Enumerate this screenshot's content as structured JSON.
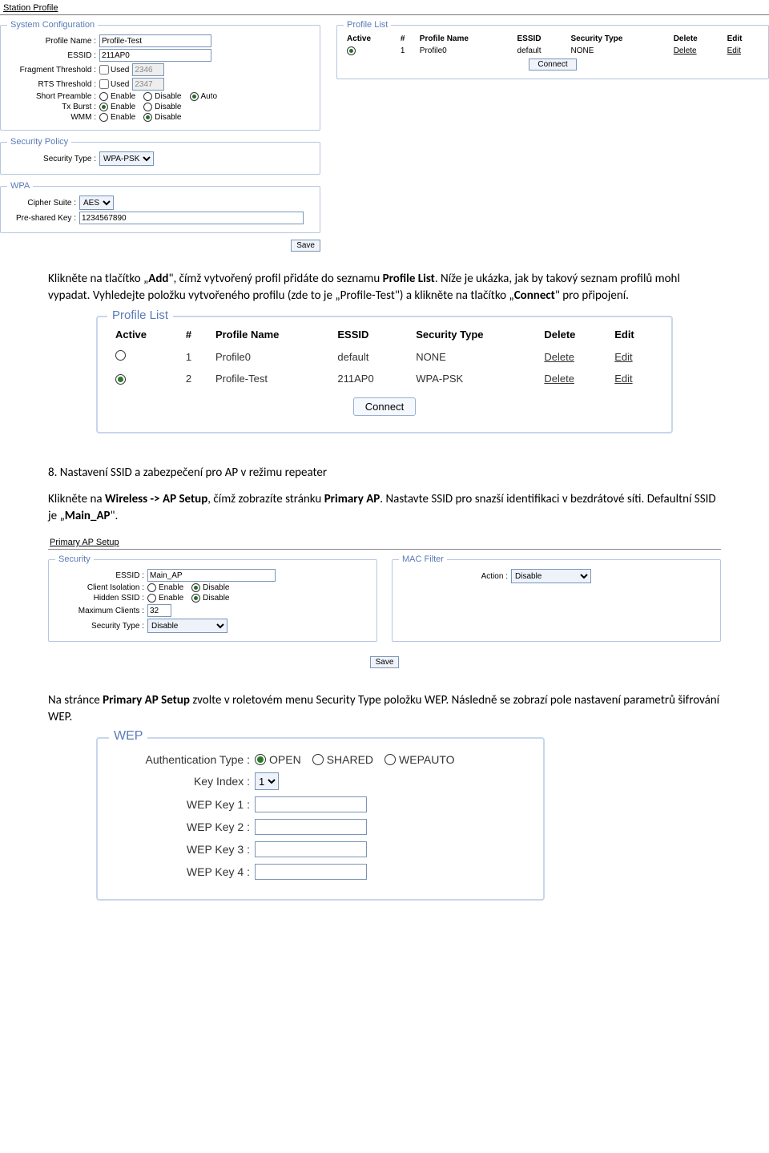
{
  "station_profile": {
    "title": "Station Profile",
    "sysconf": {
      "legend": "System Configuration",
      "profile_name_label": "Profile Name :",
      "profile_name_value": "Profile-Test",
      "essid_label": "ESSID :",
      "essid_value": "211AP0",
      "frag_label": "Fragment Threshold :",
      "frag_chk_label": "Used",
      "frag_value": "2346",
      "rts_label": "RTS Threshold :",
      "rts_chk_label": "Used",
      "rts_value": "2347",
      "preamble_label": "Short Preamble :",
      "enable": "Enable",
      "disable": "Disable",
      "auto": "Auto",
      "txburst_label": "Tx Burst :",
      "wmm_label": "WMM :"
    },
    "security_policy": {
      "legend": "Security Policy",
      "type_label": "Security Type :",
      "type_value": "WPA-PSK"
    },
    "wpa": {
      "legend": "WPA",
      "cipher_label": "Cipher Suite :",
      "cipher_value": "AES",
      "psk_label": "Pre-shared Key :",
      "psk_value": "1234567890"
    },
    "save": "Save",
    "profile_list": {
      "legend": "Profile List",
      "headers": [
        "Active",
        "#",
        "Profile Name",
        "ESSID",
        "Security Type",
        "Delete",
        "Edit"
      ],
      "rows": [
        {
          "active": true,
          "num": "1",
          "name": "Profile0",
          "essid": "default",
          "sec": "NONE",
          "del": "Delete",
          "edit": "Edit"
        }
      ],
      "connect": "Connect"
    }
  },
  "para1_a": "Klikněte na tlačítko „",
  "para1_b": "Add",
  "para1_c": "\", čímž vytvořený profil přidáte do seznamu ",
  "para1_d": "Profile List",
  "para1_e": ". Níže je ukázka, jak by takový seznam profilů mohl vypadat. Vyhledejte položku vytvořeného profilu (zde to je „Profile-Test\") a klikněte na tlačítko „",
  "para1_f": "Connect",
  "para1_g": "\" pro připojení.",
  "big_profile_list": {
    "legend": "Profile List",
    "headers": [
      "Active",
      "#",
      "Profile Name",
      "ESSID",
      "Security Type",
      "Delete",
      "Edit"
    ],
    "rows": [
      {
        "active": false,
        "num": "1",
        "name": "Profile0",
        "essid": "default",
        "sec": "NONE",
        "del": "Delete",
        "edit": "Edit"
      },
      {
        "active": true,
        "num": "2",
        "name": "Profile-Test",
        "essid": "211AP0",
        "sec": "WPA-PSK",
        "del": "Delete",
        "edit": "Edit"
      }
    ],
    "connect": "Connect"
  },
  "section8": "8. Nastavení SSID a zabezpečení pro AP v režimu repeater",
  "para2_a": "Klikněte na ",
  "para2_b": "Wireless -> AP Setup",
  "para2_c": ", čímž zobrazíte stránku ",
  "para2_d": "Primary AP",
  "para2_e": ". Nastavte SSID pro snazší identifikaci v bezdrátové síti. Defaultní SSID je „",
  "para2_f": "Main_AP",
  "para2_g": "\".",
  "primary_ap": {
    "title": "Primary AP Setup",
    "security": {
      "legend": "Security",
      "essid_label": "ESSID :",
      "essid_value": "Main_AP",
      "iso_label": "Client Isolation :",
      "hidden_label": "Hidden SSID :",
      "enable": "Enable",
      "disable": "Disable",
      "max_label": "Maximum Clients :",
      "max_value": "32",
      "type_label": "Security Type :",
      "type_value": "Disable"
    },
    "mac_filter": {
      "legend": "MAC Filter",
      "action_label": "Action :",
      "action_value": "Disable"
    },
    "save": "Save"
  },
  "para3_a": "Na stránce ",
  "para3_b": "Primary AP Setup",
  "para3_c": " zvolte v roletovém menu Security Type položku WEP. Následně se zobrazí pole nastavení parametrů šifrování WEP.",
  "wep": {
    "legend": "WEP",
    "auth_label": "Authentication Type :",
    "open": "OPEN",
    "shared": "SHARED",
    "wepauto": "WEPAUTO",
    "keyidx_label": "Key Index :",
    "keyidx_value": "1",
    "k1": "WEP Key 1 :",
    "k2": "WEP Key 2 :",
    "k3": "WEP Key 3 :",
    "k4": "WEP Key 4 :"
  }
}
